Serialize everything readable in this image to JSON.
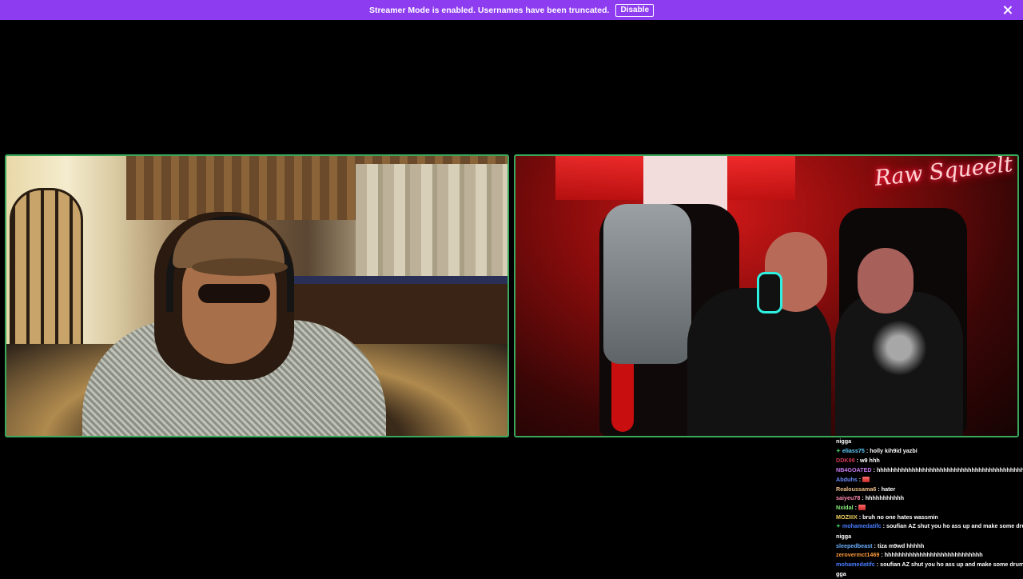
{
  "banner": {
    "message": "Streamer Mode is enabled. Usernames have been truncated.",
    "disable_label": "Disable",
    "background_color": "#8e3cf0",
    "close_icon": "close-icon"
  },
  "cams": {
    "border_color": "#3aa85a",
    "right_neon_sign": "Raw Squeelt"
  },
  "chat": {
    "lines": [
      {
        "badge": "",
        "user": "",
        "sep": "",
        "text": "nigga",
        "emote": "",
        "user_color": "#ffffff"
      },
      {
        "badge": "✦",
        "user": "eliass75",
        "sep": " : ",
        "text": "holly kih9id yazbi",
        "emote": "",
        "user_color": "#5fd0ff"
      },
      {
        "badge": "",
        "user": "DDK99",
        "sep": " : ",
        "text": "w9 hhh",
        "emote": "",
        "user_color": "#d13a5a"
      },
      {
        "badge": "",
        "user": "NB4GOATED",
        "sep": " : ",
        "text": "hhhhhhhhhhhhhhhhhhhhhhhhhhhhhhhhhhhhhhhhhhhh",
        "emote": "",
        "user_color": "#c87bf0"
      },
      {
        "badge": "",
        "user": "Abduhs",
        "sep": " : ",
        "text": "",
        "emote": "emote",
        "user_color": "#6a8cff"
      },
      {
        "badge": "",
        "user": "Realoussama6",
        "sep": " : ",
        "text": "hater",
        "emote": "",
        "user_color": "#f0c08a"
      },
      {
        "badge": "",
        "user": "saiyeu78",
        "sep": " : ",
        "text": "hhhhhhhhhhh",
        "emote": "",
        "user_color": "#ff8ab0"
      },
      {
        "badge": "",
        "user": "Nxidal",
        "sep": " : ",
        "text": "",
        "emote": "emote",
        "user_color": "#8af07a"
      },
      {
        "badge": "",
        "user": "MOZIIIX",
        "sep": " : ",
        "text": "bruh no one hates wassmin",
        "emote": "",
        "user_color": "#f0d060"
      },
      {
        "badge": "✦",
        "user": "mohamedatifc",
        "sep": " : ",
        "text": "soufian AZ shut you ho ass up and make some drums",
        "emote": "",
        "user_color": "#4a7cff"
      },
      {
        "badge": "",
        "user": "",
        "sep": "",
        "text": "nigga",
        "emote": "",
        "user_color": "#ffffff"
      },
      {
        "badge": "",
        "user": "sleepedbeast",
        "sep": " : ",
        "text": "tiza m9wd hhhhh",
        "emote": "",
        "user_color": "#6ab0ff"
      },
      {
        "badge": "",
        "user": "zerovermct1469",
        "sep": " : ",
        "text": "hhhhhhhhhhhhhhhhhhhhhhhhhhhh",
        "emote": "",
        "user_color": "#ff9a3a"
      },
      {
        "badge": "",
        "user": "mohamedatifc",
        "sep": " : ",
        "text": "soufian AZ shut you ho ass up and make some drums",
        "emote": "",
        "user_color": "#4a7cff"
      },
      {
        "badge": "",
        "user": "",
        "sep": "",
        "text": "gga",
        "emote": "",
        "user_color": "#ffffff"
      }
    ]
  }
}
